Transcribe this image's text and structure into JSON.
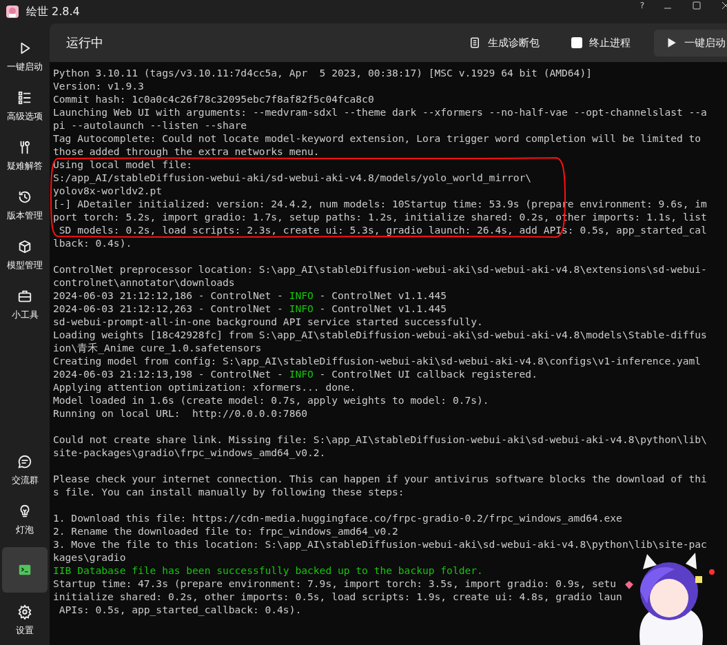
{
  "window": {
    "title": "绘世 2.8.4",
    "help": "?"
  },
  "sidebar": {
    "items": [
      {
        "label": "一键启动",
        "selected": false
      },
      {
        "label": "高级选项",
        "selected": false
      },
      {
        "label": "疑难解答",
        "selected": false
      },
      {
        "label": "版本管理",
        "selected": false
      },
      {
        "label": "模型管理",
        "selected": false
      },
      {
        "label": "小工具",
        "selected": false
      }
    ],
    "bottom_items": [
      {
        "label": "交流群",
        "selected": false
      },
      {
        "label": "灯泡",
        "selected": false
      },
      {
        "selected": true
      },
      {
        "label": "设置",
        "selected": false
      }
    ]
  },
  "header": {
    "title": "运行中",
    "diagnose_button": "生成诊断包",
    "stop_process": {
      "label": "终止进程",
      "checked": false
    },
    "launch_button": "一键启动"
  },
  "console": {
    "blocks": [
      [
        {
          "text": "Python 3.10.11 (tags/v3.10.11:7d4cc5a, Apr  5 2023, 00:38:17) [MSC v.1929 64 bit (AMD64)]"
        },
        {
          "text": "Version: v1.9.3"
        },
        {
          "text": "Commit hash: 1c0a0c4c26f78c32095ebc7f8af82f5c04fca8c0"
        },
        {
          "text": "Launching Web UI with arguments: --medvram-sdxl --theme dark --xformers --no-half-vae --opt-channelslast --a"
        },
        {
          "text": "pi --autolaunch --listen --share"
        },
        {
          "text": "Tag Autocomplete: Could not locate model-keyword extension, Lora trigger word completion will be limited to"
        },
        {
          "text": "those added through the extra networks menu."
        },
        {
          "text": "Using local model file:"
        },
        {
          "text": "S:/app_AI/stableDiffusion-webui-aki/sd-webui-aki-v4.8/models/yolo_world_mirror\\"
        },
        {
          "text": "yolov8x-worldv2.pt"
        },
        {
          "text": "[-] ADetailer initialized: version: 24.4.2, num models: 10Startup time: 53.9s (prepare environment: 9.6s, im"
        },
        {
          "text": "port torch: 5.2s, import gradio: 1.7s, setup paths: 1.2s, initialize shared: 0.2s, other imports: 1.1s, list"
        },
        {
          "text": " SD models: 0.2s, load scripts: 2.3s, create ui: 5.3s, gradio launch: 26.4s, add APIs: 0.5s, app_started_cal"
        },
        {
          "text": "lback: 0.4s)."
        }
      ],
      [
        {
          "text": "ControlNet preprocessor location: S:\\app_AI\\stableDiffusion-webui-aki\\sd-webui-aki-v4.8\\extensions\\sd-webui-"
        },
        {
          "text": "controlnet\\annotator\\downloads"
        },
        {
          "parts": [
            {
              "text": "2024-06-03 21:12:12,186 - ControlNet - ",
              "green": false
            },
            {
              "text": "INFO",
              "green": true
            },
            {
              "text": " - ControlNet v1.1.445",
              "green": false
            }
          ]
        },
        {
          "parts": [
            {
              "text": "2024-06-03 21:12:12,263 - ControlNet - ",
              "green": false
            },
            {
              "text": "INFO",
              "green": true
            },
            {
              "text": " - ControlNet v1.1.445",
              "green": false
            }
          ]
        },
        {
          "text": "sd-webui-prompt-all-in-one background API service started successfully."
        },
        {
          "text": "Loading weights [18c42928fc] from S:\\app_AI\\stableDiffusion-webui-aki\\sd-webui-aki-v4.8\\models\\Stable-diffus"
        },
        {
          "text": "ion\\青禾_Anime cure_1.0.safetensors"
        },
        {
          "text": "Creating model from config: S:\\app_AI\\stableDiffusion-webui-aki\\sd-webui-aki-v4.8\\configs\\v1-inference.yaml"
        },
        {
          "parts": [
            {
              "text": "2024-06-03 21:12:13,198 - ControlNet - ",
              "green": false
            },
            {
              "text": "INFO",
              "green": true
            },
            {
              "text": " - ControlNet UI callback registered.",
              "green": false
            }
          ]
        },
        {
          "text": "Applying attention optimization: xformers... done."
        },
        {
          "text": "Model loaded in 1.6s (create model: 0.7s, apply weights to model: 0.7s)."
        },
        {
          "text": "Running on local URL:  http://0.0.0.0:7860"
        }
      ],
      [
        {
          "text": "Could not create share link. Missing file: S:\\app_AI\\stableDiffusion-webui-aki\\sd-webui-aki-v4.8\\python\\lib\\"
        },
        {
          "text": "site-packages\\gradio\\frpc_windows_amd64_v0.2."
        }
      ],
      [
        {
          "text": "Please check your internet connection. This can happen if your antivirus software blocks the download of thi"
        },
        {
          "text": "s file. You can install manually by following these steps:"
        }
      ],
      [
        {
          "text": "1. Download this file: https://cdn-media.huggingface.co/frpc-gradio-0.2/frpc_windows_amd64.exe"
        },
        {
          "text": "2. Rename the downloaded file to: frpc_windows_amd64_v0.2"
        },
        {
          "text": "3. Move the file to this location: S:\\app_AI\\stableDiffusion-webui-aki\\sd-webui-aki-v4.8\\python\\lib\\site-pac"
        },
        {
          "text": "kages\\gradio"
        },
        {
          "text": "IIB Database file has been successfully backed up to the backup folder.",
          "green": true
        },
        {
          "text": "Startup time: 47.3s (prepare environment: 7.9s, import torch: 3.5s, import gradio: 0.9s, setu"
        },
        {
          "text": "initialize shared: 0.2s, other imports: 0.5s, load scripts: 1.9s, create ui: 4.8s, gradio laun"
        },
        {
          "text": " APIs: 0.5s, app_started_callback: 0.4s)."
        }
      ]
    ]
  }
}
